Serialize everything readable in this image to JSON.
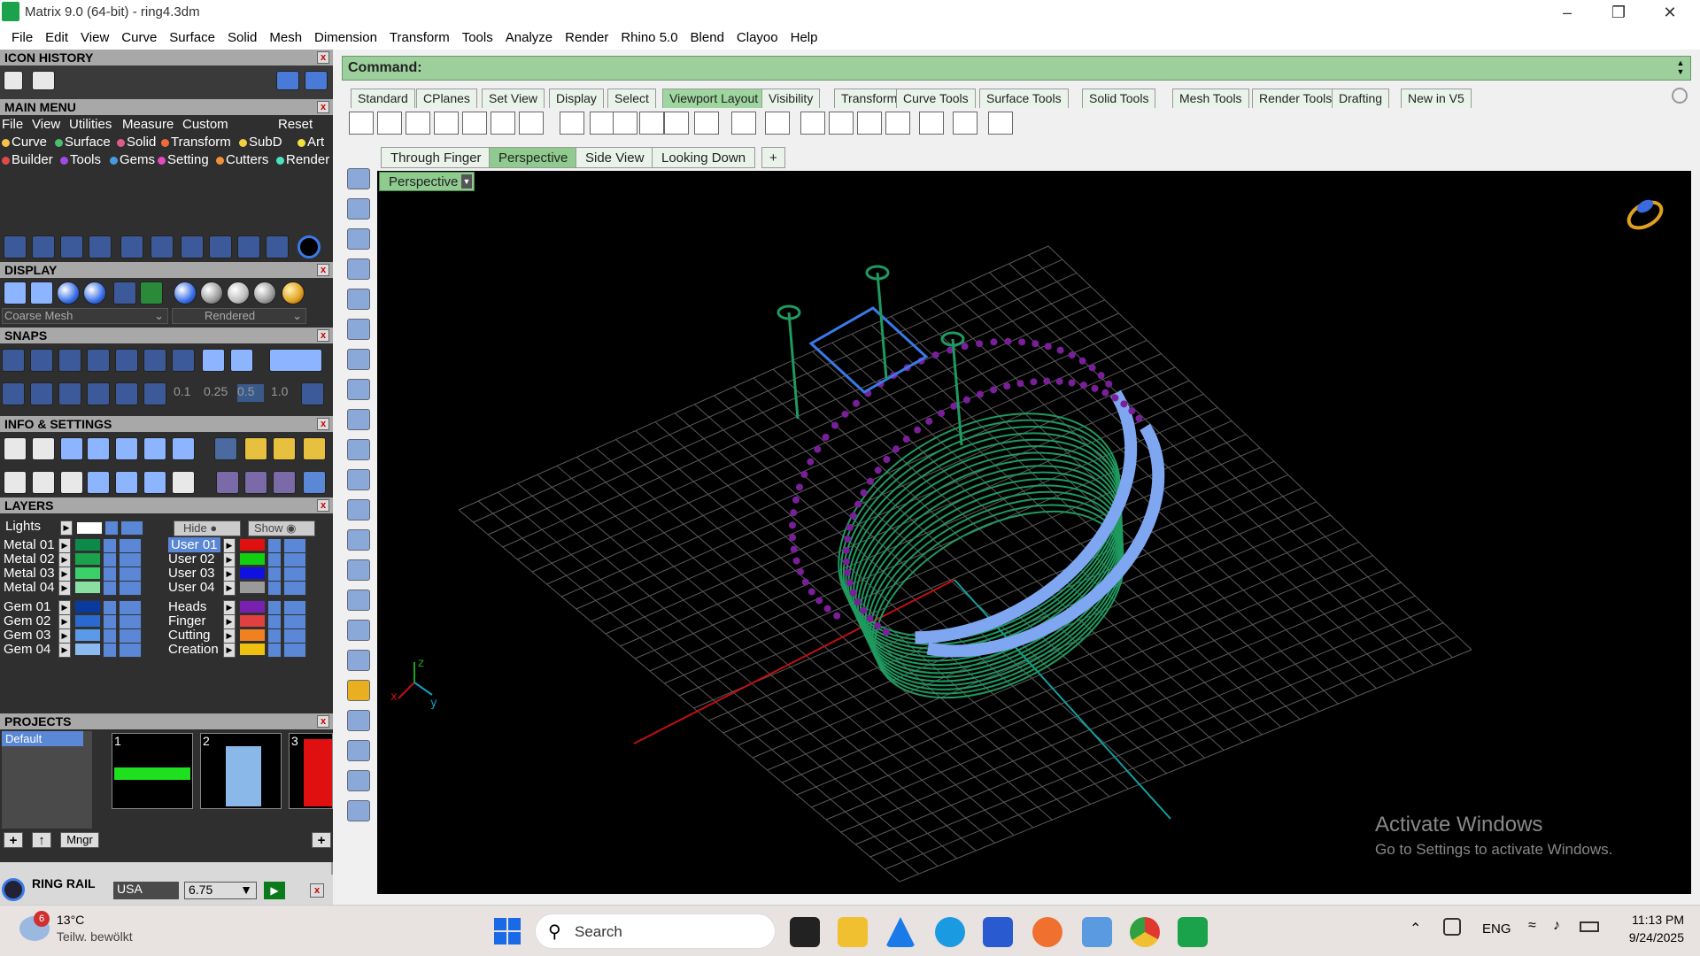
{
  "window": {
    "title": "Matrix 9.0 (64-bit) - ring4.3dm"
  },
  "menubar": [
    "File",
    "Edit",
    "View",
    "Curve",
    "Surface",
    "Solid",
    "Mesh",
    "Dimension",
    "Transform",
    "Tools",
    "Analyze",
    "Render",
    "Rhino 5.0",
    "Blend",
    "Clayoo",
    "Help"
  ],
  "left": {
    "icon_history": "ICON HISTORY",
    "main_menu": "MAIN MENU",
    "mm_row1": [
      "File",
      "View",
      "Utilities",
      "Measure",
      "Custom",
      "Reset"
    ],
    "mm_row2": [
      "Curve",
      "Surface",
      "Solid",
      "Transform",
      "SubD",
      "Art"
    ],
    "mm_row3": [
      "Builder",
      "Tools",
      "Gems",
      "Setting",
      "Cutters",
      "Render"
    ],
    "display": "DISPLAY",
    "display_select1": "Coarse Mesh",
    "display_select2": "Rendered",
    "snaps": "SNAPS",
    "snap_values": [
      "0.1",
      "0.25",
      "0.5",
      "1.0"
    ],
    "info": "INFO & SETTINGS",
    "layers": "LAYERS",
    "lights": "Lights",
    "hide": "Hide",
    "show": "Show",
    "layer_left": [
      "Metal 01",
      "Metal 02",
      "Metal 03",
      "Metal 04",
      "Gem 01",
      "Gem 02",
      "Gem 03",
      "Gem 04"
    ],
    "layer_right": [
      "User 01",
      "User 02",
      "User 03",
      "User 04",
      "Heads",
      "Finger",
      "Cutting",
      "Creation"
    ],
    "projects": "PROJECTS",
    "project_default": "Default",
    "project_slots": [
      "1",
      "2",
      "3"
    ],
    "mngr": "Mngr",
    "ring_rail": "RING RAIL",
    "ring_standard": "USA",
    "ring_size": "6.75"
  },
  "command": {
    "label": "Command:"
  },
  "toolbar_tabs": [
    "Standard",
    "CPlanes",
    "Set View",
    "Display",
    "Select",
    "Viewport Layout",
    "Visibility",
    "Transform",
    "Curve Tools",
    "Surface Tools",
    "Solid Tools",
    "Mesh Tools",
    "Render Tools",
    "Drafting",
    "New in V5"
  ],
  "active_toolbar_tab": "Viewport Layout",
  "viewport_tabs": [
    "Through Finger",
    "Perspective",
    "Side View",
    "Looking Down"
  ],
  "viewport_add": "+",
  "viewport_label": "Perspective",
  "axis": {
    "x": "x",
    "y": "y",
    "z": "z"
  },
  "watermark": {
    "line1": "Activate Windows",
    "line2": "Go to Settings to activate Windows."
  },
  "taskbar": {
    "weather_temp": "13°C",
    "weather_desc": "Teilw. bewölkt",
    "weather_badge": "6",
    "search": "Search",
    "lang": "ENG",
    "time": "11:13 PM",
    "date": "9/24/2025"
  },
  "colors": {
    "command_bar": "#9ccf9c",
    "wire_green": "#1f9a5f",
    "gem_blue": "#7fa6f0",
    "prong_purple": "#7a1f9a"
  }
}
